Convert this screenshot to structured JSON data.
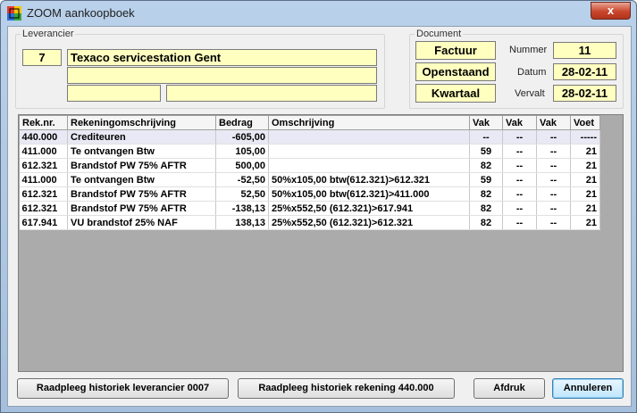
{
  "window": {
    "title": "ZOOM aankoopboek",
    "close_label": "x"
  },
  "leverancier": {
    "legend": "Leverancier",
    "number": "7",
    "name": "Texaco servicestation Gent",
    "address_line": "",
    "postal_code": "",
    "city": ""
  },
  "document": {
    "legend": "Document",
    "type": "Factuur",
    "status": "Openstaand",
    "period": "Kwartaal",
    "nummer_label": "Nummer",
    "nummer": "11",
    "datum_label": "Datum",
    "datum": "28-02-11",
    "vervalt_label": "Vervalt",
    "vervalt": "28-02-11"
  },
  "table": {
    "columns": [
      "Rek.nr.",
      "Rekeningomschrijving",
      "Bedrag",
      "Omschrijving",
      "Vak",
      "Vak",
      "Vak",
      "Voet"
    ],
    "rows": [
      [
        "440.000",
        "Crediteuren",
        "-605,00",
        "",
        "--",
        "--",
        "--",
        "-----"
      ],
      [
        "411.000",
        "Te ontvangen Btw",
        "105,00",
        "",
        "59",
        "--",
        "--",
        "21"
      ],
      [
        "612.321",
        "Brandstof PW 75% AFTR",
        "500,00",
        "",
        "82",
        "--",
        "--",
        "21"
      ],
      [
        "411.000",
        "Te ontvangen Btw",
        "-52,50",
        "50%x105,00 btw(612.321)>612.321",
        "59",
        "--",
        "--",
        "21"
      ],
      [
        "612.321",
        "Brandstof PW 75% AFTR",
        "52,50",
        "50%x105,00 btw(612.321)>411.000",
        "82",
        "--",
        "--",
        "21"
      ],
      [
        "612.321",
        "Brandstof PW 75% AFTR",
        "-138,13",
        "25%x552,50 (612.321)>617.941",
        "82",
        "--",
        "--",
        "21"
      ],
      [
        "617.941",
        "VU brandstof 25% NAF",
        "138,13",
        "25%x552,50 (612.321)>612.321",
        "82",
        "--",
        "--",
        "21"
      ]
    ]
  },
  "buttons": {
    "hist_lev": "Raadpleeg historiek leverancier 0007",
    "hist_rek": "Raadpleeg historiek rekening 440.000",
    "afdruk": "Afdruk",
    "annuleren": "Annuleren"
  },
  "colors": {
    "field_bg": "#ffffc0",
    "client_bg": "#f0f0f0",
    "close_red": "#c9462c"
  }
}
